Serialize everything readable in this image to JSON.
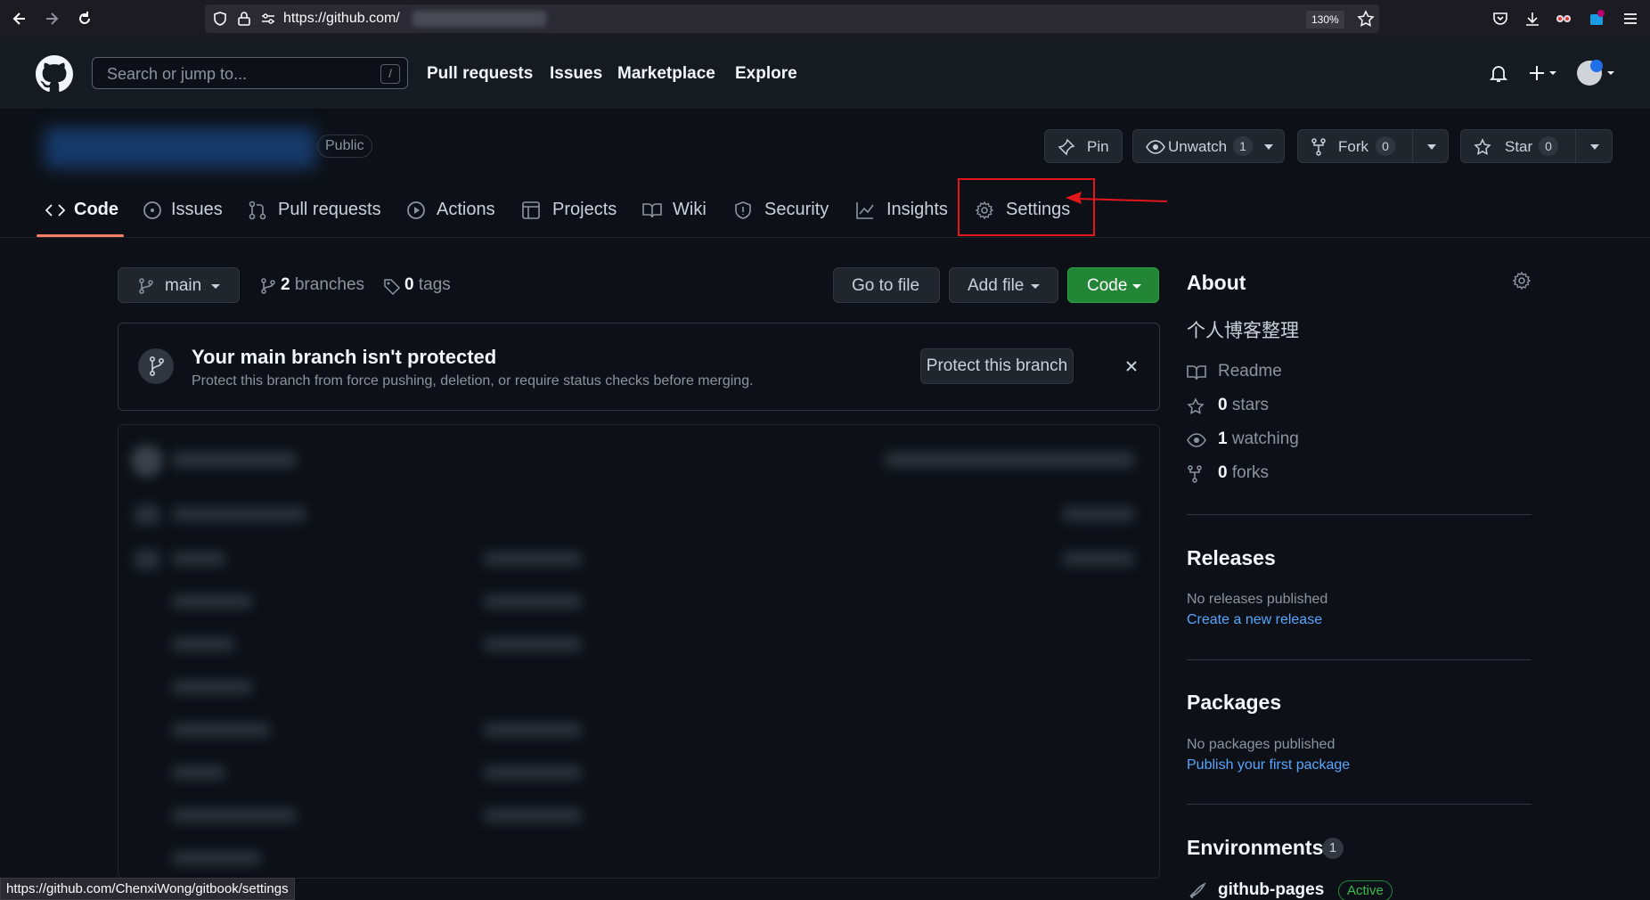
{
  "browser": {
    "url_prefix": "https://github.com/",
    "zoom": "130%",
    "status_url": "https://github.com/ChenxiWong/gitbook/settings",
    "icons": [
      "back-icon",
      "forward-icon",
      "reload-icon",
      "shield-icon",
      "lock-icon",
      "permissions-icon",
      "bookmark-star-icon",
      "pocket-icon",
      "download-icon",
      "extension-icon",
      "extension-badge-icon",
      "menu-icon"
    ]
  },
  "header": {
    "search_placeholder": "Search or jump to...",
    "search_key": "/",
    "nav": [
      "Pull requests",
      "Issues",
      "Marketplace",
      "Explore"
    ]
  },
  "repo": {
    "visibility": "Public",
    "pin_label": "Pin",
    "unwatch_label": "Unwatch",
    "unwatch_count": "1",
    "fork_label": "Fork",
    "fork_count": "0",
    "star_label": "Star",
    "star_count": "0"
  },
  "tabs": [
    {
      "label": "Code"
    },
    {
      "label": "Issues"
    },
    {
      "label": "Pull requests"
    },
    {
      "label": "Actions"
    },
    {
      "label": "Projects"
    },
    {
      "label": "Wiki"
    },
    {
      "label": "Security"
    },
    {
      "label": "Insights"
    },
    {
      "label": "Settings"
    }
  ],
  "main": {
    "branch": "main",
    "branches_count": "2",
    "branches_label": "branches",
    "tags_count": "0",
    "tags_label": "tags",
    "go_to_file": "Go to file",
    "add_file": "Add file",
    "code_btn": "Code",
    "protect_title": "Your main branch isn't protected",
    "protect_desc": "Protect this branch from force pushing, deletion, or require status checks before merging.",
    "protect_btn": "Protect this branch"
  },
  "sidebar": {
    "about_title": "About",
    "description": "个人博客整理",
    "readme": "Readme",
    "stars_count": "0",
    "stars_label": "stars",
    "watching_count": "1",
    "watching_label": "watching",
    "forks_count": "0",
    "forks_label": "forks",
    "releases_title": "Releases",
    "releases_none": "No releases published",
    "releases_link": "Create a new release",
    "packages_title": "Packages",
    "packages_none": "No packages published",
    "packages_link": "Publish your first package",
    "environments_title": "Environments",
    "environments_count": "1",
    "env_name": "github-pages",
    "env_status": "Active"
  },
  "colors": {
    "bg": "#0d1117",
    "header_bg": "#161b22",
    "accent_green": "#238636",
    "link_blue": "#58a6ff",
    "tab_underline": "#f78166",
    "annotation_red": "#e3161c"
  }
}
